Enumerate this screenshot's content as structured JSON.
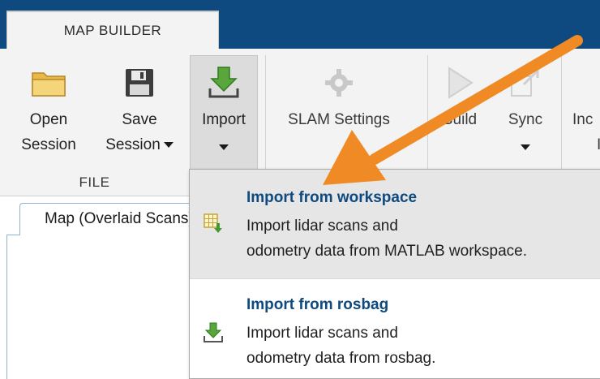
{
  "tab": {
    "title": "MAP BUILDER"
  },
  "toolbar": {
    "open_session": {
      "line1": "Open",
      "line2": "Session"
    },
    "save_session": {
      "line1": "Save",
      "line2": "Session"
    },
    "import": {
      "label": "Import"
    },
    "slam_settings": {
      "label": "SLAM Settings"
    },
    "build": {
      "label": "Build"
    },
    "sync": {
      "label": "Sync"
    },
    "next_partial": {
      "line1": "Inc",
      "line2": "I"
    },
    "group_file": "FILE"
  },
  "document": {
    "tab_label": "Map (Overlaid Scans)"
  },
  "import_menu": {
    "items": [
      {
        "title": "Import from workspace",
        "desc_line1": "Import lidar scans and",
        "desc_line2": "odometry data from MATLAB workspace."
      },
      {
        "title": "Import from rosbag",
        "desc_line1": "Import lidar scans and",
        "desc_line2": "odometry data from rosbag."
      }
    ]
  },
  "colors": {
    "title_bar": "#0e4a7f",
    "menu_title": "#0e4a7f",
    "annotation_arrow": "#f08a24",
    "ribbon_bg": "#f3f3f3"
  },
  "icons": [
    "folder-icon",
    "floppy-disk-icon",
    "import-arrow-icon",
    "gear-icon",
    "play-icon",
    "sync-icon",
    "table-import-icon",
    "download-tray-icon"
  ]
}
